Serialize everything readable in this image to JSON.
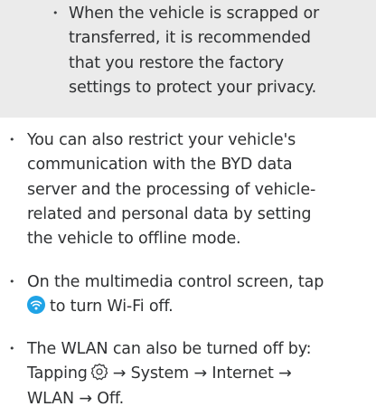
{
  "note": {
    "lines": [
      "When the vehicle is scrapped or",
      "transferred, it is recommended",
      "that you restore the factory",
      "settings to protect your privacy."
    ]
  },
  "items": [
    {
      "lines": [
        "You can also restrict your vehicle's",
        "communication with the BYD data",
        "server and the processing of vehicle-",
        "related and personal data by setting",
        "the vehicle to offline mode."
      ]
    },
    {
      "line1": "On the multimedia control screen, tap",
      "line2_after_icon": "to turn Wi-Fi off."
    },
    {
      "line1": "The WLAN can also be turned off by:",
      "line2_before_icon": "Tapping",
      "line2_after_icon": "→ System → Internet →",
      "line3": "WLAN → Off."
    }
  ],
  "bullet_char": "•",
  "icons": {
    "wifi": "wifi-icon",
    "settings": "gear-icon"
  },
  "colors": {
    "note_background": "#ebebeb",
    "text": "#2f3133",
    "wifi_icon": "#1fa3e6"
  }
}
